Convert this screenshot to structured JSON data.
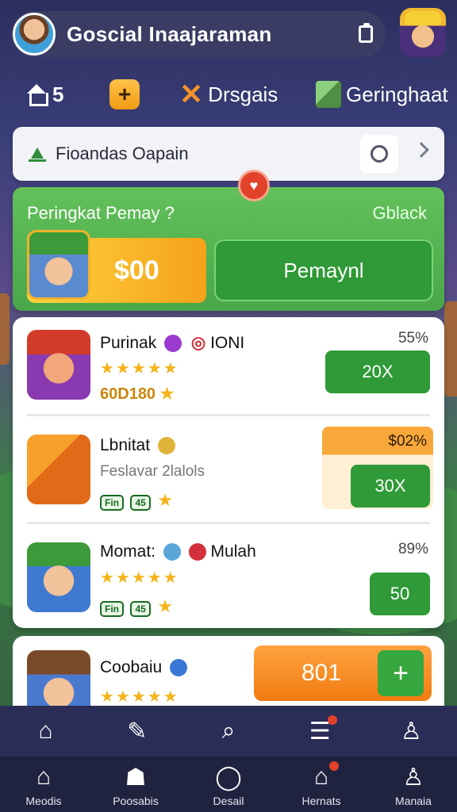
{
  "header": {
    "title": "Goscial Inaajaraman"
  },
  "stats": {
    "home_count": "5",
    "tools_label": "Drsgais",
    "cube_label": "Geringhaat"
  },
  "search": {
    "text": "Fioandas Oapain"
  },
  "promo": {
    "title": "Peringkat Pemay ?",
    "link": "Gblack",
    "price": "$00",
    "button": "Pemaynl"
  },
  "games": [
    {
      "name": "Purinak",
      "extra": "IONI",
      "score": "60D180",
      "percent": "55%",
      "button": "20X"
    },
    {
      "name": "Lbnitat",
      "sub": "Feslavar 2lalols",
      "offer": "$02%",
      "button": "30X",
      "chips": [
        "Fin",
        "45"
      ]
    },
    {
      "name": "Momat:",
      "extra": "Mulah",
      "percent": "89%",
      "button": "50",
      "chips": [
        "Fin",
        "45"
      ]
    },
    {
      "name": "Coobaiu",
      "price": "801",
      "plus": "+"
    }
  ],
  "nav_bottom": [
    "Meodis",
    "Poosabis",
    "Desail",
    "Hernats",
    "Manaia"
  ],
  "colors": {
    "accent_green": "#2f9a37",
    "accent_orange": "#f5a21a",
    "nav_bg": "#20233f"
  }
}
